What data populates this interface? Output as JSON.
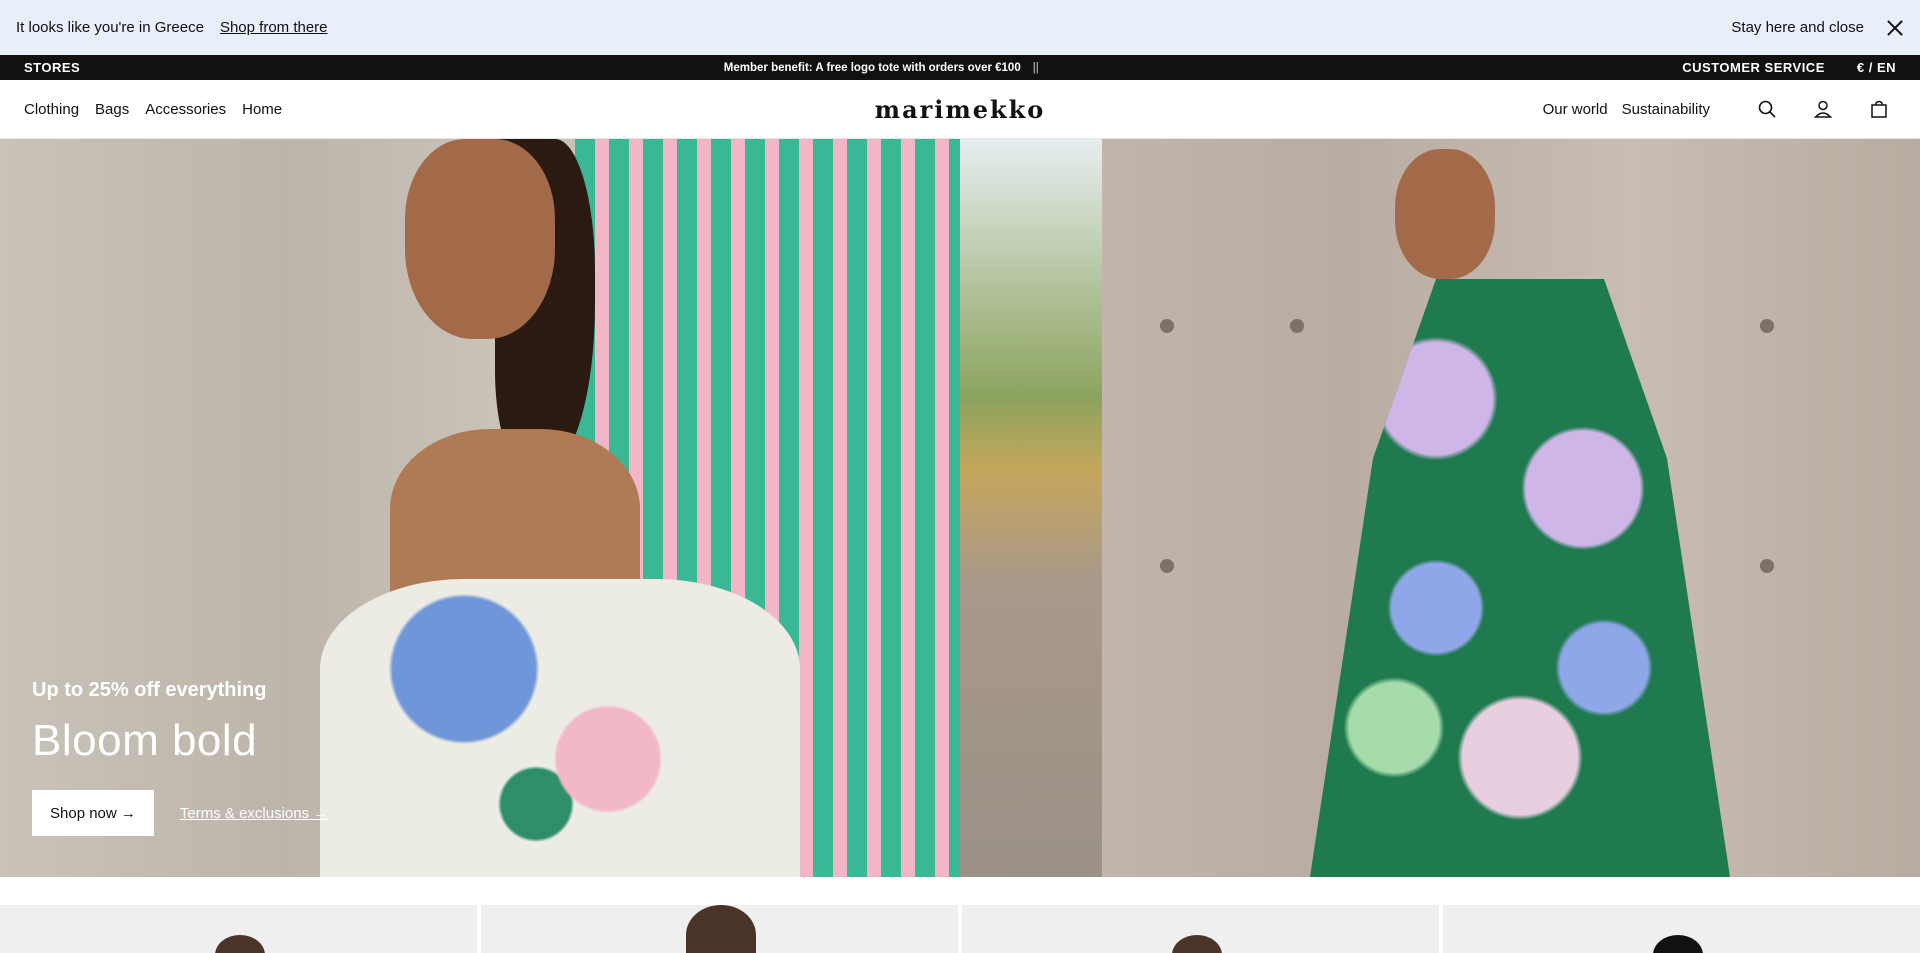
{
  "geo_banner": {
    "message": "It looks like you're in Greece",
    "shop_link": "Shop from there",
    "stay_button": "Stay here and close",
    "close_icon": "close-icon"
  },
  "promo_bar": {
    "stores": "STORES",
    "message": "Member benefit: A free logo tote with orders over €100",
    "separator": "||",
    "customer_service": "CUSTOMER SERVICE",
    "locale": "€ / EN"
  },
  "nav": {
    "logo": "marimekko",
    "categories": [
      "Clothing",
      "Bags",
      "Accessories",
      "Home"
    ],
    "secondary": [
      "Our world",
      "Sustainability"
    ],
    "icons": [
      "search-icon",
      "account-icon",
      "bag-icon"
    ]
  },
  "hero": {
    "eyebrow": "Up to 25% off everything",
    "title": "Bloom bold",
    "cta": "Shop now →",
    "terms": "Terms & exclusions →"
  }
}
